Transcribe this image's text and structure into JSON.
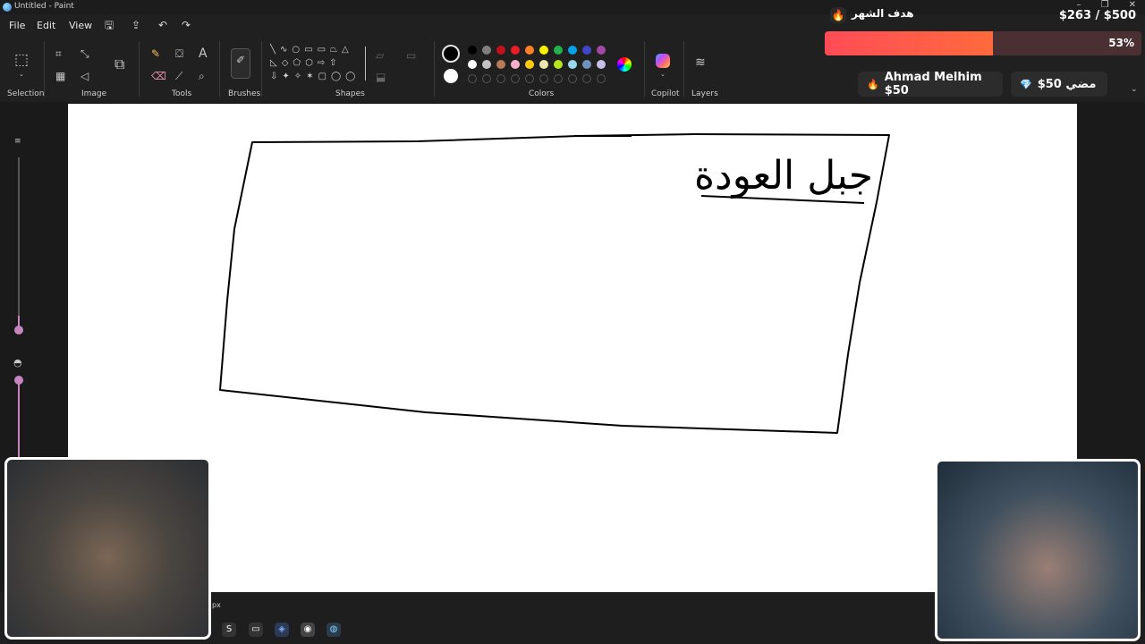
{
  "window": {
    "title": "Untitled - Paint"
  },
  "menu": {
    "file": "File",
    "edit": "Edit",
    "view": "View"
  },
  "ribbon": {
    "groups": {
      "selection": "Selection",
      "image": "Image",
      "tools": "Tools",
      "brushes": "Brushes",
      "shapes": "Shapes",
      "colors": "Colors",
      "copilot": "Copilot",
      "layers": "Layers"
    },
    "palette_top": [
      "#000000",
      "#7f7f7f",
      "#c3101c",
      "#ec1c24",
      "#ff7f27",
      "#fff200",
      "#22b14c",
      "#00a2e8",
      "#3f48cc",
      "#a349a4"
    ],
    "palette_bottom": [
      "#ffffff",
      "#c3c3c3",
      "#b97a57",
      "#ffaec9",
      "#ffc90e",
      "#efe4b0",
      "#b5e61d",
      "#99d9ea",
      "#7092be",
      "#c8bfe7"
    ]
  },
  "overlay": {
    "goal_title": "هدف الشهر",
    "goal_amount": "$263 / $500",
    "goal_percent": "53%",
    "goal_fraction": 0.53,
    "donor1": "Ahmad Melhim $50",
    "donor2": "$50 مضي"
  },
  "canvas": {
    "handwriting": "جبل العودة"
  },
  "status": {
    "size_unit": "px"
  }
}
